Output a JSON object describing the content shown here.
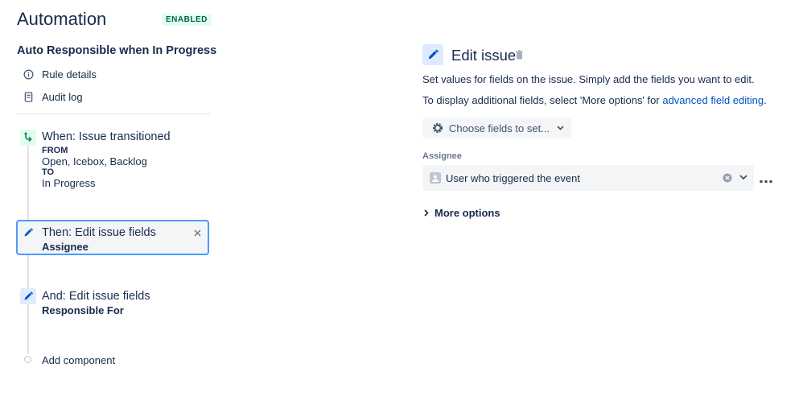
{
  "header": {
    "title": "Automation",
    "badge": "ENABLED"
  },
  "rule": {
    "name": "Auto Responsible when In Progress"
  },
  "nav": {
    "rule_details": "Rule details",
    "audit_log": "Audit log"
  },
  "trigger": {
    "title": "When: Issue transitioned",
    "from_label": "FROM",
    "from_value": "Open, Icebox, Backlog",
    "to_label": "TO",
    "to_value": "In Progress"
  },
  "action1": {
    "title": "Then: Edit issue fields",
    "subtitle": "Assignee"
  },
  "action2": {
    "title": "And: Edit issue fields",
    "subtitle": "Responsible For"
  },
  "add_component": "Add component",
  "editor": {
    "title": "Edit issue",
    "description": "Set values for fields on the issue. Simply add the fields you want to edit.",
    "more_text_prefix": "To display additional fields, select 'More options' for ",
    "more_text_link": "advanced field editing",
    "more_text_suffix": ".",
    "choose_button": "Choose fields to set...",
    "field_label": "Assignee",
    "field_value": "User who triggered the event",
    "more_options": "More options"
  },
  "colors": {
    "accent": "#0052cc",
    "selected_border": "#4c9aff",
    "badge_bg": "#e3fcef",
    "badge_text": "#006644",
    "trigger_icon": "#00875a"
  },
  "icons": {
    "rule_details": "info-icon",
    "audit_log": "document-icon",
    "trigger": "branch-icon",
    "action": "pencil-icon",
    "delete": "trash-icon",
    "settings": "gear-icon",
    "chevron": "chevron-down-icon",
    "clear": "clear-icon",
    "more": "more-icon"
  }
}
